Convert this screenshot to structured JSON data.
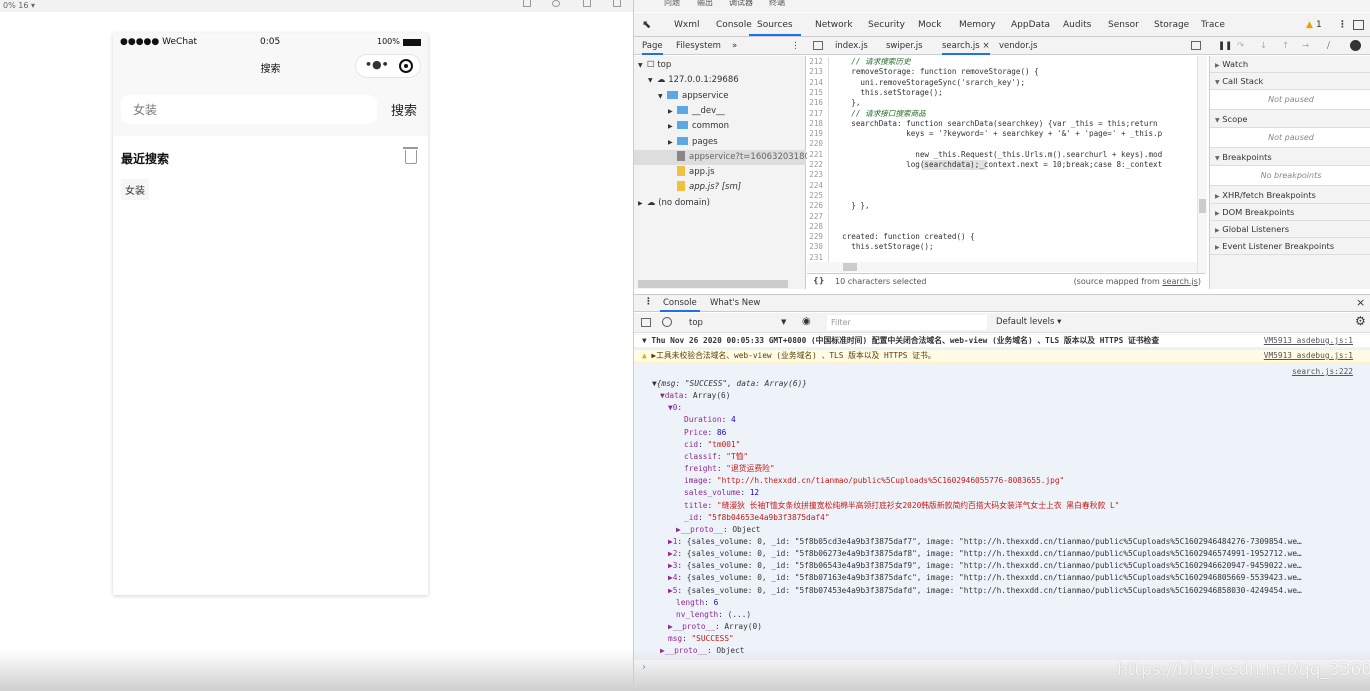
{
  "simulator": {
    "top_label": "0% 16 ▾"
  },
  "phone": {
    "carrier": "●●●●● WeChat",
    "time": "0:05",
    "battery": "100%",
    "nav_title": "搜索",
    "search_placeholder": "女装",
    "search_button": "搜索",
    "recent_title": "最近搜索",
    "history": [
      "女装"
    ]
  },
  "devtools": {
    "top_tabs": [
      "问题",
      "输出",
      "调试器",
      "终端"
    ],
    "main_tabs": [
      "Wxml",
      "Console",
      "Sources",
      "Network",
      "Security",
      "Mock",
      "Memory",
      "AppData",
      "Audits",
      "Sensor",
      "Storage",
      "Trace"
    ],
    "active_tab": "Sources",
    "warning_count": "1",
    "nav_tabs": [
      "Page",
      "Filesystem"
    ],
    "file_tabs": [
      "index.js",
      "swiper.js",
      "search.js",
      "vendor.js"
    ],
    "tree": [
      {
        "label": "top",
        "level": 0,
        "type": "frame",
        "arrow": "▼"
      },
      {
        "label": "127.0.0.1:29686",
        "level": 1,
        "type": "cloud",
        "arrow": "▼"
      },
      {
        "label": "appservice",
        "level": 2,
        "type": "folder",
        "arrow": "▼"
      },
      {
        "label": "__dev__",
        "level": 3,
        "type": "folder",
        "arrow": "▶"
      },
      {
        "label": "common",
        "level": 3,
        "type": "folder",
        "arrow": "▶"
      },
      {
        "label": "pages",
        "level": 3,
        "type": "folder",
        "arrow": "▶"
      },
      {
        "label": "appservice?t=1606320318051",
        "level": 3,
        "type": "file-gray",
        "arrow": ""
      },
      {
        "label": "app.js",
        "level": 3,
        "type": "file",
        "arrow": ""
      },
      {
        "label": "app.js? [sm]",
        "level": 3,
        "type": "file",
        "arrow": ""
      },
      {
        "label": "(no domain)",
        "level": 0,
        "type": "cloud",
        "arrow": "▶"
      }
    ],
    "code": [
      {
        "n": "212",
        "t": "    // 请求搜索历史",
        "c": true
      },
      {
        "n": "213",
        "t": "    removeStorage: function removeStorage() {"
      },
      {
        "n": "214",
        "t": "      uni.removeStorageSync('srarch_key');"
      },
      {
        "n": "215",
        "t": "      this.setStorage();"
      },
      {
        "n": "216",
        "t": "    },"
      },
      {
        "n": "217",
        "t": "    // 请求接口搜索商品",
        "c": true
      },
      {
        "n": "218",
        "t": "    searchData: function searchData(searchkey) {var _this = this;return"
      },
      {
        "n": "219",
        "t": "                keys = '?keyword=' + searchkey + '&' + 'page=' + _this.p"
      },
      {
        "n": "220",
        "t": ""
      },
      {
        "n": "221",
        "t": "                  new _this.Request(_this.Urls.m().searchurl + keys).mod"
      },
      {
        "n": "222",
        "t": "                log(searchdata);_context.next = 10;break;case 8:_context"
      },
      {
        "n": "223",
        "t": ""
      },
      {
        "n": "224",
        "t": ""
      },
      {
        "n": "225",
        "t": ""
      },
      {
        "n": "226",
        "t": "    } },"
      },
      {
        "n": "227",
        "t": ""
      },
      {
        "n": "228",
        "t": ""
      },
      {
        "n": "229",
        "t": "  created: function created() {"
      },
      {
        "n": "230",
        "t": "    this.setStorage();"
      },
      {
        "n": "231",
        "t": ""
      }
    ],
    "status_left": "10 characters selected",
    "status_right_prefix": "(source mapped from ",
    "status_right_link": "search.js",
    "status_right_suffix": ")",
    "debug_sections": [
      {
        "title": "Watch",
        "arrow": "▶"
      },
      {
        "title": "Call Stack",
        "arrow": "▼",
        "body": "Not paused"
      },
      {
        "title": "Scope",
        "arrow": "▼",
        "body": "Not paused"
      },
      {
        "title": "Breakpoints",
        "arrow": "▼",
        "body": "No breakpoints"
      },
      {
        "title": "XHR/fetch Breakpoints",
        "arrow": "▶"
      },
      {
        "title": "DOM Breakpoints",
        "arrow": "▶"
      },
      {
        "title": "Global Listeners",
        "arrow": "▶"
      },
      {
        "title": "Event Listener Breakpoints",
        "arrow": "▶"
      }
    ],
    "drawer_tabs": [
      "Console",
      "What's New"
    ],
    "context": "top",
    "filter_placeholder": "Filter",
    "levels": "Default levels ▾",
    "console": [
      {
        "text": "▼ Thu Nov 26 2020 00:05:33 GMT+0800 (中国标准时间) 配置中关闭合法域名、web-view (业务域名) 、TLS 版本以及 HTTPS 证书检查",
        "src": "VM5913 asdebug.js:1",
        "bold": true
      },
      {
        "text": "▶工具未校验合法域名、web-view (业务域名) 、TLS 版本以及 HTTPS 证书。",
        "src": "VM5913 asdebug.js:1",
        "warn": true
      }
    ],
    "log_source": "search.js:222",
    "tree_lines": [
      {
        "i": 0,
        "k": "▼{msg: \"SUCCESS\", data: Array(6)}",
        "v": "",
        "vt": "o"
      },
      {
        "i": 1,
        "k": "▼data",
        "v": ": Array(6)",
        "vt": "o"
      },
      {
        "i": 2,
        "k": "▼0",
        "v": ":",
        "vt": "o"
      },
      {
        "i": 3,
        "k": "Duration",
        "v": ": 4",
        "vt": "n"
      },
      {
        "i": 3,
        "k": "Price",
        "v": ": 86",
        "vt": "n"
      },
      {
        "i": 3,
        "k": "cid",
        "v": ": \"tm001\"",
        "vt": "s"
      },
      {
        "i": 3,
        "k": "classif",
        "v": ": \"T恤\"",
        "vt": "s"
      },
      {
        "i": 3,
        "k": "freight",
        "v": ": \"退货运费险\"",
        "vt": "s"
      },
      {
        "i": 3,
        "k": "image",
        "v": ": \"http://h.thexxdd.cn/tianmao/public%5Cuploads%5C1602946055776-8083655.jpg\"",
        "vt": "s"
      },
      {
        "i": 3,
        "k": "sales_volume",
        "v": ": 12",
        "vt": "n"
      },
      {
        "i": 3,
        "k": "title",
        "v": ": \"缝漫狄 长袖T恤女条纹拼撞宽松纯棉半高领打底衫女2020韩版新款简约百搭大码女装洋气女士上衣 黑白春秋款 L\"",
        "vt": "s"
      },
      {
        "i": 3,
        "k": "_id",
        "v": ": \"5f8b04653e4a9b3f3875daf4\"",
        "vt": "s"
      },
      {
        "i": 3,
        "k": "▶__proto__",
        "v": ": Object",
        "vt": "o"
      },
      {
        "i": 2,
        "k": "▶1",
        "v": ": {sales_volume: 0, _id: \"5f8b05cd3e4a9b3f3875daf7\", image: \"http://h.thexxdd.cn/tianmao/public%5Cuploads%5C1602946484276-7309854.we…",
        "vt": "o"
      },
      {
        "i": 2,
        "k": "▶2",
        "v": ": {sales_volume: 0, _id: \"5f8b06273e4a9b3f3875daf8\", image: \"http://h.thexxdd.cn/tianmao/public%5Cuploads%5C1602946574991-1952712.we…",
        "vt": "o"
      },
      {
        "i": 2,
        "k": "▶3",
        "v": ": {sales_volume: 0, _id: \"5f8b06543e4a9b3f3875daf9\", image: \"http://h.thexxdd.cn/tianmao/public%5Cuploads%5C1602946620947-9459022.we…",
        "vt": "o"
      },
      {
        "i": 2,
        "k": "▶4",
        "v": ": {sales_volume: 0, _id: \"5f8b07163e4a9b3f3875dafc\", image: \"http://h.thexxdd.cn/tianmao/public%5Cuploads%5C1602946805669-5539423.we…",
        "vt": "o"
      },
      {
        "i": 2,
        "k": "▶5",
        "v": ": {sales_volume: 0, _id: \"5f8b07453e4a9b3f3875dafd\", image: \"http://h.thexxdd.cn/tianmao/public%5Cuploads%5C1602946858030-4249454.we…",
        "vt": "o"
      },
      {
        "i": 2,
        "k": "length",
        "v": ": 6",
        "vt": "n"
      },
      {
        "i": 2,
        "k": "nv_length",
        "v": ": (...)",
        "vt": "o"
      },
      {
        "i": 2,
        "k": "▶__proto__",
        "v": ": Array(0)",
        "vt": "o"
      },
      {
        "i": 1,
        "k": "msg",
        "v": ": \"SUCCESS\"",
        "vt": "s"
      },
      {
        "i": 1,
        "k": "▶__proto__",
        "v": ": Object",
        "vt": "o"
      }
    ],
    "prompt": "›"
  },
  "watermark": "https://blog.csdn.net/qq_33608000"
}
